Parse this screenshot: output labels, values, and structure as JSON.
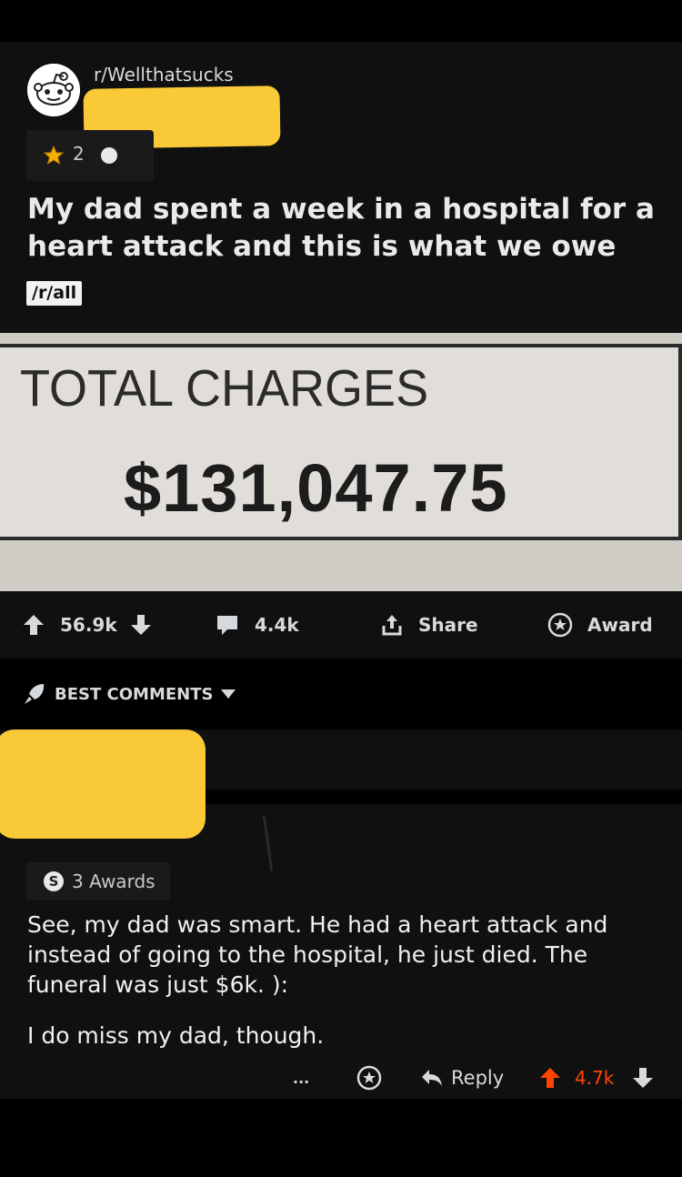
{
  "post": {
    "subreddit": "r/Wellthatsucks",
    "award_count": "2",
    "title": "My dad spent a week in a hospital for a heart attack and this is what we owe",
    "flair": "/r/all",
    "image": {
      "label": "TOTAL CHARGES",
      "amount": "$131,047.75"
    },
    "actions": {
      "votes": "56.9k",
      "comments": "4.4k",
      "share_label": "Share",
      "award_label": "Award"
    }
  },
  "comments_sort": {
    "label": "BEST COMMENTS"
  },
  "comment": {
    "awards_label": "3 Awards",
    "body": "See, my dad was smart. He had a heart attack and instead of going to the hospital, he just died. The funeral was just $6k. ):",
    "body2": "I do miss my dad, though.",
    "more": "...",
    "reply_label": "Reply",
    "votes": "4.7k"
  },
  "colors": {
    "background": "#000000",
    "card": "#101010",
    "upvote": "#ff4500",
    "redaction": "#f9c938"
  },
  "icons": [
    "reddit-snoo-icon",
    "award-icon",
    "upvote-icon",
    "downvote-icon",
    "comment-icon",
    "share-icon",
    "star-award-icon",
    "rocket-sort-icon",
    "caret-down-icon",
    "silver-award-icon",
    "reply-icon"
  ]
}
